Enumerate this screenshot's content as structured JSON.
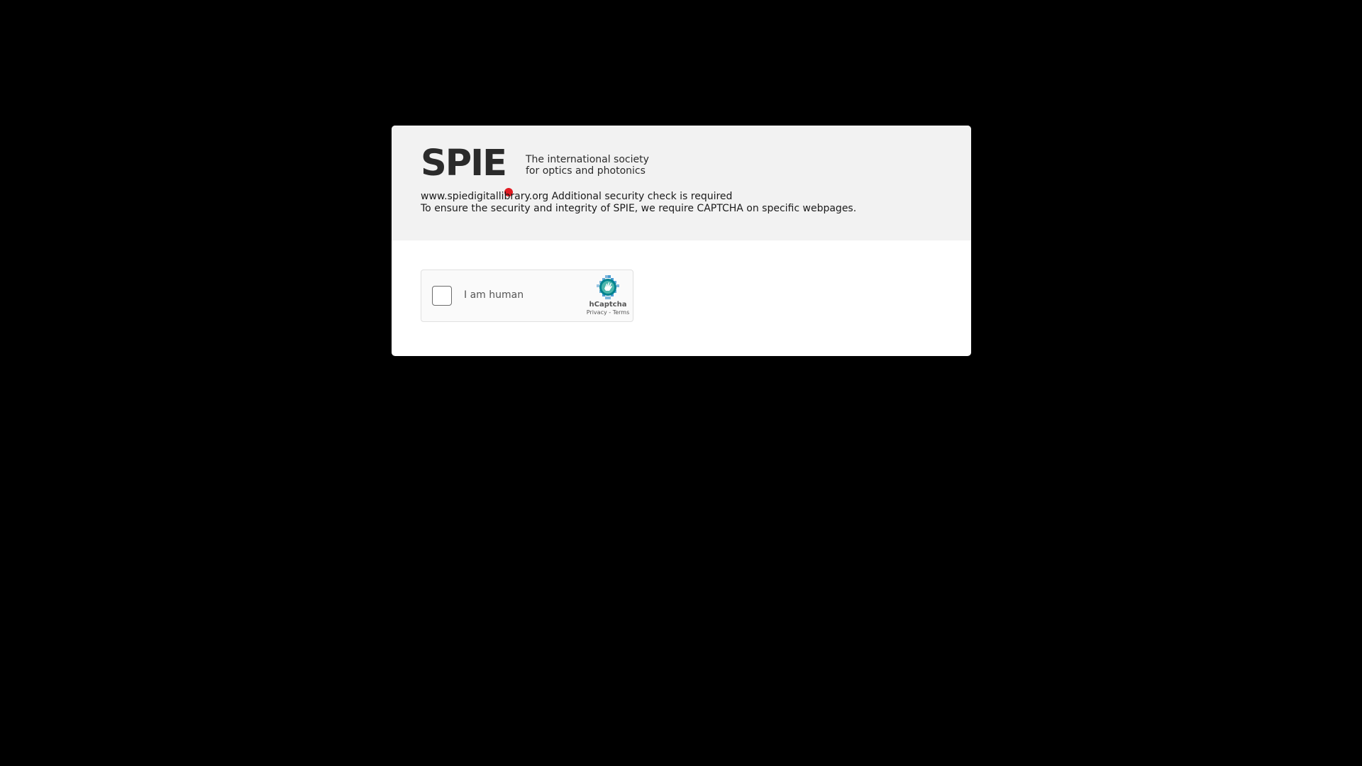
{
  "brand": {
    "name": "SPIE",
    "dot_color": "#e11b22",
    "tagline_line1": "The international society",
    "tagline_line2": "for optics and photonics"
  },
  "message": {
    "line1": "www.spiedigitallibrary.org Additional security check is required",
    "line2": "To ensure the security and integrity of SPIE, we require CAPTCHA on specific webpages."
  },
  "captcha": {
    "checkbox_label": "I am human",
    "provider_name": "hCaptcha",
    "provider_icon": "hcaptcha-hand-icon",
    "privacy_link": "Privacy",
    "separator": " - ",
    "terms_link": "Terms",
    "checked": false
  }
}
